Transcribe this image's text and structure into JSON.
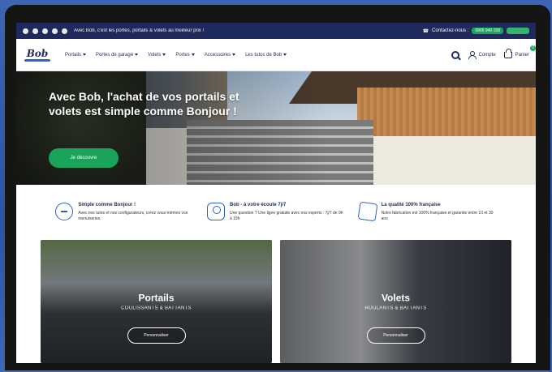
{
  "topbar": {
    "social_icons": [
      "facebook-icon",
      "instagram-icon",
      "youtube-icon",
      "twitter-icon",
      "pinterest-icon"
    ],
    "message": "Avec Bob, c'est les portes, portails & volets au meilleur prix !",
    "contact_label": "Contactez-nous :",
    "phone": "0805 940 158"
  },
  "nav": {
    "logo_text": "Bob",
    "items": [
      {
        "label": "Portails"
      },
      {
        "label": "Portes de garage"
      },
      {
        "label": "Volets"
      },
      {
        "label": "Portes"
      },
      {
        "label": "Accessoires"
      },
      {
        "label": "Les tutos de Bob"
      }
    ],
    "account_label": "Compte",
    "cart_label": "Panier",
    "cart_count": "0"
  },
  "hero": {
    "headline": "Avec Bob, l'achat de vos portails et volets est simple comme Bonjour !",
    "cta_label": "Je découvre"
  },
  "features": [
    {
      "icon": "thumbs-up-icon",
      "title": "Simple comme Bonjour !",
      "desc": "Avec nos tutos et nos configurateurs, créez vous-mêmes vos menuiseries."
    },
    {
      "icon": "headset-icon",
      "title": "Bob - à votre écoute 7j/7",
      "desc": "Une question ? Une ligne gratuite avec nos experts : 7j/7 de 9h à 19h"
    },
    {
      "icon": "france-map-icon",
      "title": "La qualité 100% française",
      "desc": "Notre fabrication est 100% française et garantie entre 10 et 30 ans"
    }
  ],
  "cards": [
    {
      "title": "Portails",
      "subtitle": "COULISSANTS & BATTANTS",
      "button": "Personnaliser"
    },
    {
      "title": "Volets",
      "subtitle": "ROULANTS & BATTANTS",
      "button": "Personnaliser"
    }
  ],
  "colors": {
    "topbar_bg": "#1f2a5c",
    "accent_green": "#1aa35b",
    "brand_blue": "#2b63c6"
  }
}
